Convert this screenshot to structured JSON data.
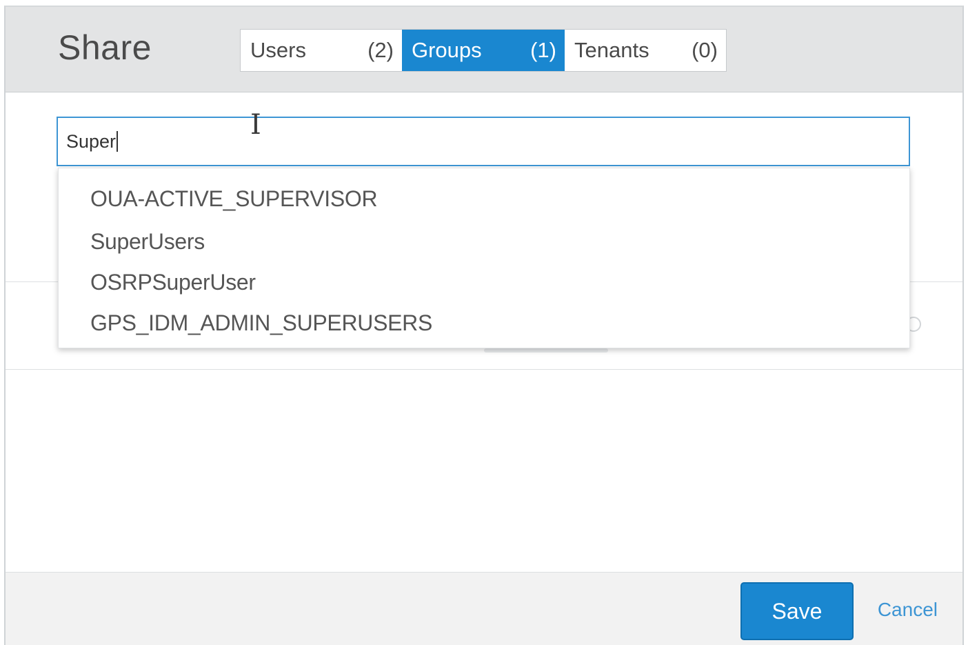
{
  "dialog": {
    "title": "Share"
  },
  "tabs": [
    {
      "label": "Users",
      "count": "(2)",
      "selected": false
    },
    {
      "label": "Groups",
      "count": "(1)",
      "selected": true
    },
    {
      "label": "Tenants",
      "count": "(0)",
      "selected": false
    }
  ],
  "search": {
    "value": "Super"
  },
  "suggestions": [
    "OUA-ACTIVE_SUPERVISOR",
    "SuperUsers",
    "OSRPSuperUser",
    "GPS_IDM_ADMIN_SUPERUSERS"
  ],
  "footer": {
    "save_label": "Save",
    "cancel_label": "Cancel"
  },
  "colors": {
    "accent": "#1a87d0",
    "header_bg": "#e3e4e5",
    "link": "#3d95d4"
  },
  "icons": {
    "cursor": "text-cursor-ibeam-icon"
  }
}
